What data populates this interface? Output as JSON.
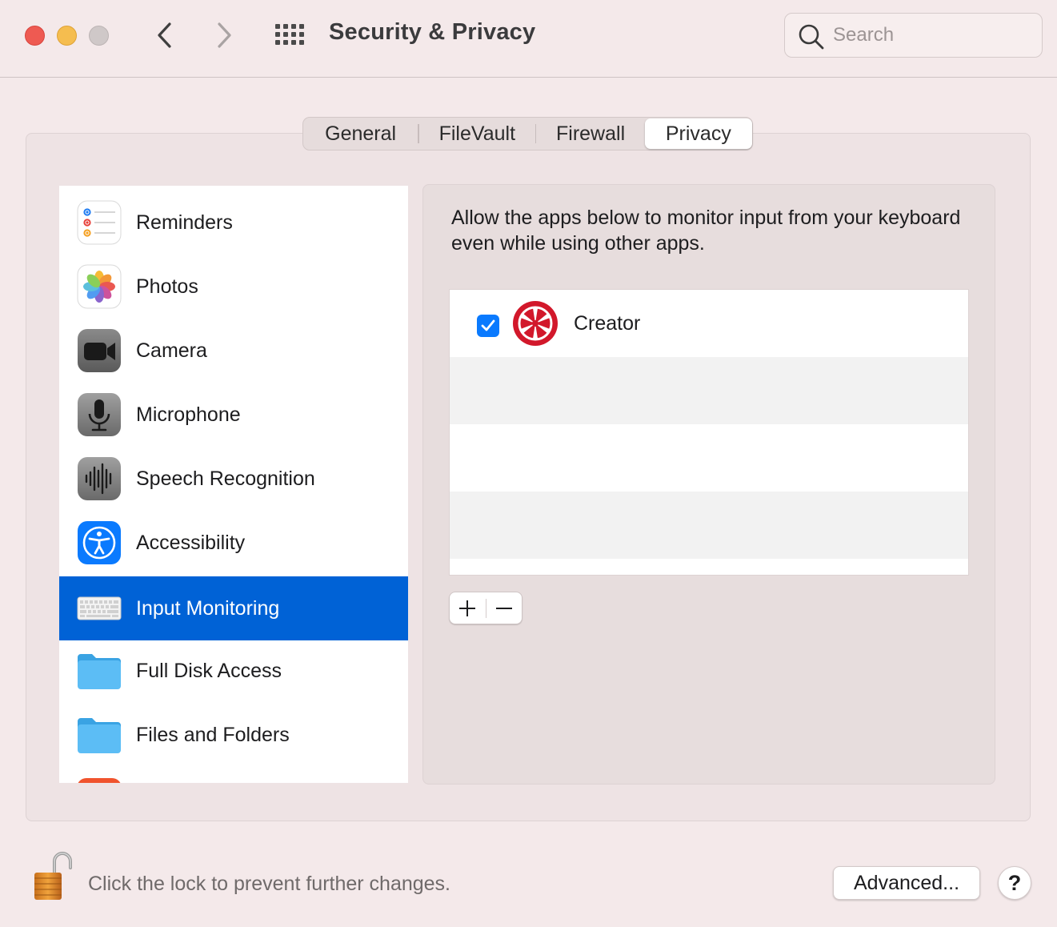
{
  "window": {
    "title": "Security & Privacy"
  },
  "search": {
    "placeholder": "Search"
  },
  "tabs": [
    {
      "label": "General"
    },
    {
      "label": "FileVault"
    },
    {
      "label": "Firewall"
    },
    {
      "label": "Privacy",
      "selected": true
    }
  ],
  "sidebar": {
    "items": [
      {
        "label": "Reminders",
        "icon": "reminders-icon"
      },
      {
        "label": "Photos",
        "icon": "photos-icon"
      },
      {
        "label": "Camera",
        "icon": "camera-icon"
      },
      {
        "label": "Microphone",
        "icon": "microphone-icon"
      },
      {
        "label": "Speech Recognition",
        "icon": "speech-recognition-icon"
      },
      {
        "label": "Accessibility",
        "icon": "accessibility-icon"
      },
      {
        "label": "Input Monitoring",
        "icon": "keyboard-icon",
        "selected": true
      },
      {
        "label": "Full Disk Access",
        "icon": "folder-icon"
      },
      {
        "label": "Files and Folders",
        "icon": "folder-icon"
      }
    ]
  },
  "content": {
    "description": "Allow the apps below to monitor input from your keyboard even while using other apps.",
    "apps": [
      {
        "name": "Creator",
        "checked": true,
        "icon": "creator-app-icon"
      }
    ]
  },
  "footer": {
    "lock_text": "Click the lock to prevent further changes.",
    "advanced_label": "Advanced...",
    "help_label": "?"
  },
  "colors": {
    "accent": "#0062d6",
    "checkbox": "#0a7afe",
    "creator_red": "#d2182b"
  }
}
